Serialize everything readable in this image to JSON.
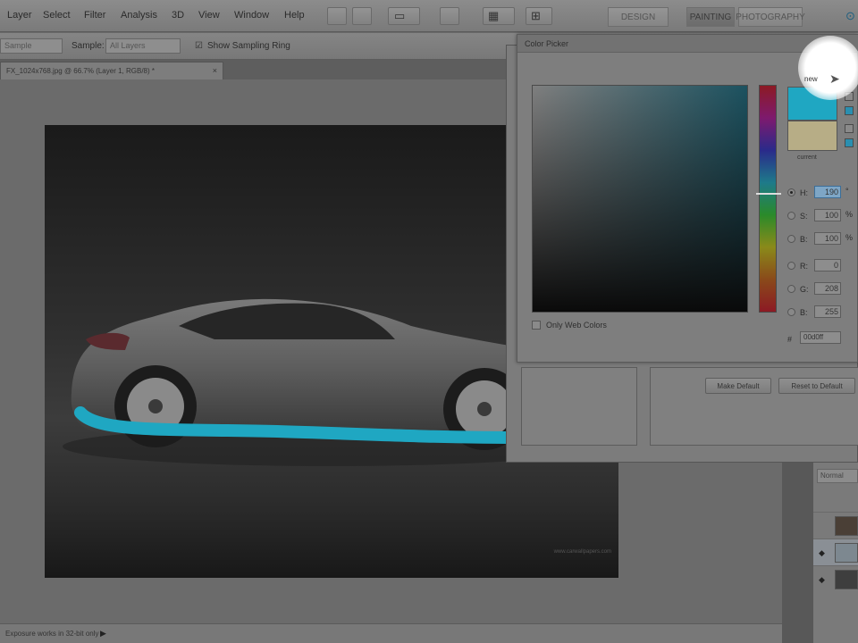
{
  "menubar": {
    "items": [
      "Layer",
      "Select",
      "Filter",
      "Analysis",
      "3D",
      "View",
      "Window",
      "Help"
    ],
    "workspaces": [
      "DESIGN",
      "PAINTING",
      "PHOTOGRAPHY"
    ]
  },
  "options": {
    "sample_size_value": "Sample",
    "sample_label": "Sample:",
    "sample_value": "All Layers",
    "show_ring_label": "Show Sampling Ring"
  },
  "document": {
    "tab_title": "FX_1024x768.jpg @ 66.7% (Layer 1, RGB/8) *",
    "close_glyph": "×",
    "watermark": "www.carwallpapers.com"
  },
  "status": {
    "text": "Exposure works in 32-bit only",
    "arrow": "▶"
  },
  "preferences": {
    "make_default": "Make Default",
    "reset_to_default": "Reset to Default"
  },
  "color_picker": {
    "title": "Color Picker",
    "new_label": "new",
    "current_label": "current",
    "new_color": "#1fa7c2",
    "current_color": "#b7ad86",
    "only_web_colors": "Only Web Colors",
    "fields": [
      {
        "label": "H:",
        "value": "190",
        "unit": "°",
        "selected": true
      },
      {
        "label": "S:",
        "value": "100",
        "unit": "%",
        "selected": false
      },
      {
        "label": "B:",
        "value": "100",
        "unit": "%",
        "selected": false
      },
      {
        "label": "R:",
        "value": "0",
        "unit": "",
        "selected": false
      },
      {
        "label": "G:",
        "value": "208",
        "unit": "",
        "selected": false
      },
      {
        "label": "B:",
        "value": "255",
        "unit": "",
        "selected": false
      }
    ],
    "hex_label": "#",
    "hex_value": "00d0ff"
  },
  "layers": {
    "blend_mode": "Normal"
  },
  "icons": {
    "eye": "eye-icon",
    "warning": "warning-icon",
    "cube": "web-safe-cube-icon"
  },
  "colors": {
    "stroke": "#1fa7c2"
  }
}
